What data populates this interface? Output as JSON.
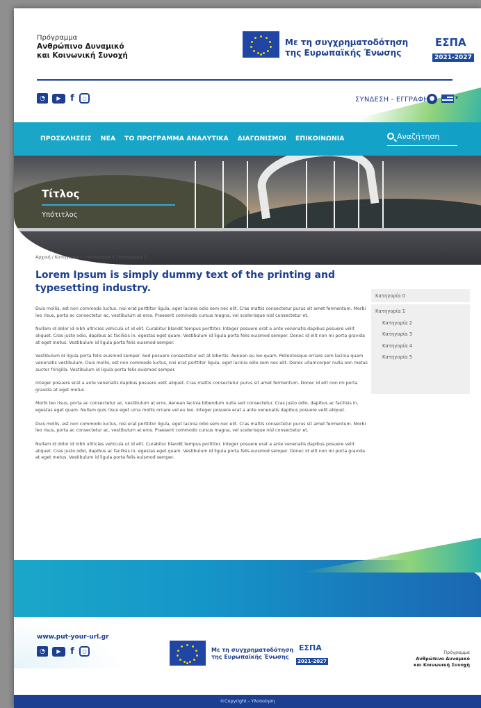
{
  "header": {
    "program_line1": "Πρόγραμμα",
    "program_line2": "Ανθρώπινο Δυναμικό",
    "program_line3": "και Κοινωνική Συνοχή",
    "cofund_line1": "Με τη συγχρηματοδότηση",
    "cofund_line2": "της Ευρωπαϊκής Ένωσης",
    "espa_mark": "ΕΣΠΑ",
    "espa_years": "2021-2027"
  },
  "utility": {
    "social": [
      "rss-icon",
      "youtube-icon",
      "facebook-icon",
      "instagram-icon"
    ],
    "login_label": "ΣΥΝΔΕΣΗ - ΕΓΓΡΑΦΗ"
  },
  "nav": {
    "items": [
      "ΠΡΟΣΚΛΗΣΕΙΣ",
      "ΝΕΑ",
      "ΤΟ ΠΡΟΓΡΑΜΜΑ ΑΝΑΛΥΤΙΚΑ",
      "ΔΙΑΓΩΝΙΣΜΟΙ",
      "ΕΠΙΚΟΙΝΩΝΙΑ"
    ],
    "search_placeholder": "Αναζήτηση"
  },
  "hero": {
    "title": "Τίτλος",
    "subtitle": "Υπότιτλος"
  },
  "breadcrumb": "Αρχική / Κατηγορία 1 / Κατηγορία 2 / Κατηγορία 3",
  "article": {
    "title": "Lorem Ipsum is simply dummy text of the printing and typesetting industry.",
    "paragraphs": [
      "Duis mollis, est non commodo luctus, nisi erat porttitor ligula, eget lacinia odio sem nec elit. Cras mattis consectetur purus sit amet fermentum. Morbi leo risus, porta ac consectetur ac, vestibulum at eros. Praesent commodo cursus magna, vel scelerisque nisl consectetur et.",
      "Nullam id dolor id nibh ultricies vehicula ut id elit. Curabitur blandit tempus porttitor. Integer posuere erat a ante venenatis dapibus posuere velit aliquet. Cras justo odio, dapibus ac facilisis in, egestas eget quam. Vestibulum id ligula porta felis euismod semper. Donec id elit non mi porta gravida at eget metus. Vestibulum id ligula porta felis euismod semper.",
      "Vestibulum id ligula porta felis euismod semper. Sed posuere consectetur est at lobortis. Aenean eu leo quam. Pellentesque ornare sem lacinia quam venenatis vestibulum. Duis mollis, est non commodo luctus, nisi erat porttitor ligula, eget lacinia odio sem nec elit. Donec ullamcorper nulla non metus auctor fringilla. Vestibulum id ligula porta felis euismod semper.",
      "Integer posuere erat a ante venenatis dapibus posuere velit aliquet. Cras mattis consectetur purus sit amet fermentum. Donec id elit non mi porta gravida at eget metus.",
      "Morbi leo risus, porta ac consectetur ac, vestibulum at eros. Aenean lacinia bibendum nulla sed consectetur. Cras justo odio, dapibus ac facilisis in, egestas eget quam. Nullam quis risus eget urna mollis ornare vel eu leo. Integer posuere erat a ante venenatis dapibus posuere velit aliquet.",
      "Duis mollis, est non commodo luctus, nisi erat porttitor ligula, eget lacinia odio sem nec elit. Cras mattis consectetur purus sit amet fermentum. Morbi leo risus, porta ac consectetur ac, vestibulum at eros. Praesent commodo cursus magna, vel scelerisque nisl consectetur et.",
      "Nullam id dolor id nibh ultricies vehicula ut id elit. Curabitur blandit tempus porttitor. Integer posuere erat a ante venenatis dapibus posuere velit aliquet. Cras justo odio, dapibus ac facilisis in, egestas eget quam. Vestibulum id ligula porta felis euismod semper. Donec id elit non mi porta gravida at eget metus. Vestibulum id ligula porta felis euismod semper."
    ]
  },
  "sidebar": {
    "top": "Κατηγορία 0",
    "group": "Κατηγορία 1",
    "subs": [
      "Κατηγορία 2",
      "Κατηγορία 3",
      "Κατηγορία 4",
      "Κατηγορία 5"
    ]
  },
  "footer": {
    "url": "www.put-your-url.gr",
    "cofund_line1": "Με τη συγχρηματοδότηση",
    "cofund_line2": "της Ευρωπαϊκής Ένωσης",
    "espa_mark": "ΕΣΠΑ",
    "espa_years": "2021-2027",
    "program_line1": "Πρόγραμμα",
    "program_line2": "Ανθρώπινο Δυναμικό",
    "program_line3": "και Κοινωνική Συνοχή",
    "copyright": "©Copyright - Υλοποίηση"
  },
  "colors": {
    "brand": "#1c3f91",
    "nav": "#16a4c9",
    "accent_green": "#8fd37a"
  }
}
